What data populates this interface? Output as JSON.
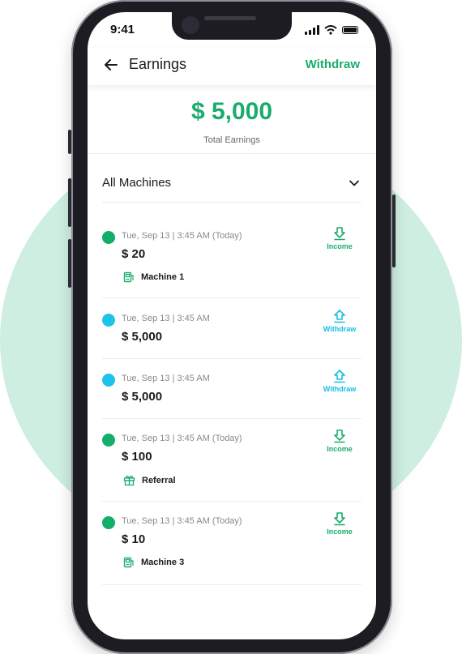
{
  "status_bar": {
    "time": "9:41"
  },
  "header": {
    "title": "Earnings",
    "withdraw_label": "Withdraw"
  },
  "summary": {
    "total_amount": "$ 5,000",
    "total_label": "Total Earnings"
  },
  "filter": {
    "selected": "All Machines"
  },
  "colors": {
    "accent": "#1aab6d",
    "income_dot": "#14ad6a",
    "withdraw_dot": "#1ec3ea",
    "withdraw_label": "#17bde3"
  },
  "transactions": [
    {
      "date": "Tue, Sep 13 | 3:45 AM (Today)",
      "amount": "$ 20",
      "type": "Income",
      "source": "Machine 1",
      "source_icon": "machine-icon"
    },
    {
      "date": "Tue, Sep 13 | 3:45 AM",
      "amount": "$ 5,000",
      "type": "Withdraw"
    },
    {
      "date": "Tue, Sep 13 | 3:45 AM",
      "amount": "$ 5,000",
      "type": "Withdraw"
    },
    {
      "date": "Tue, Sep 13 | 3:45 AM (Today)",
      "amount": "$ 100",
      "type": "Income",
      "source": "Referral",
      "source_icon": "gift-icon"
    },
    {
      "date": "Tue, Sep 13 | 3:45 AM (Today)",
      "amount": "$ 10",
      "type": "Income",
      "source": "Machine 3",
      "source_icon": "machine-icon"
    }
  ]
}
